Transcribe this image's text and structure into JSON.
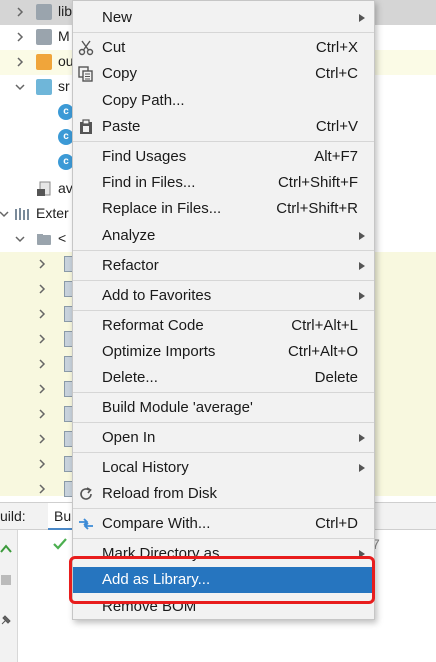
{
  "tree": {
    "items": [
      {
        "label": "lib"
      },
      {
        "label": "M"
      },
      {
        "label": "ou"
      },
      {
        "label": "sr"
      },
      {
        "label": "av"
      },
      {
        "label": "Exter"
      },
      {
        "label": "<"
      }
    ]
  },
  "build": {
    "label": "uild:",
    "tab": "Bu",
    "number": "7"
  },
  "menu": {
    "items": [
      {
        "label": "New",
        "shortcut": "",
        "submenu": true
      },
      {
        "label": "Cut",
        "shortcut": "Ctrl+X",
        "icon": "cut-icon"
      },
      {
        "label": "Copy",
        "shortcut": "Ctrl+C",
        "icon": "copy-icon"
      },
      {
        "label": "Copy Path...",
        "shortcut": ""
      },
      {
        "label": "Paste",
        "shortcut": "Ctrl+V",
        "icon": "paste-icon"
      },
      {
        "label": "Find Usages",
        "shortcut": "Alt+F7"
      },
      {
        "label": "Find in Files...",
        "shortcut": "Ctrl+Shift+F"
      },
      {
        "label": "Replace in Files...",
        "shortcut": "Ctrl+Shift+R"
      },
      {
        "label": "Analyze",
        "shortcut": "",
        "submenu": true
      },
      {
        "label": "Refactor",
        "shortcut": "",
        "submenu": true
      },
      {
        "label": "Add to Favorites",
        "shortcut": "",
        "submenu": true
      },
      {
        "label": "Reformat Code",
        "shortcut": "Ctrl+Alt+L"
      },
      {
        "label": "Optimize Imports",
        "shortcut": "Ctrl+Alt+O"
      },
      {
        "label": "Delete...",
        "shortcut": "Delete"
      },
      {
        "label": "Build Module 'average'",
        "shortcut": ""
      },
      {
        "label": "Open In",
        "shortcut": "",
        "submenu": true
      },
      {
        "label": "Local History",
        "shortcut": "",
        "submenu": true
      },
      {
        "label": "Reload from Disk",
        "shortcut": "",
        "icon": "reload-icon"
      },
      {
        "label": "Compare With...",
        "shortcut": "Ctrl+D",
        "icon": "compare-icon"
      },
      {
        "label": "Mark Directory as",
        "shortcut": "",
        "submenu": true
      },
      {
        "label": "Add as Library...",
        "shortcut": "",
        "selected": true
      },
      {
        "label": "Remove BOM",
        "shortcut": ""
      }
    ]
  },
  "colors": {
    "selection": "#2675bf",
    "highlight_box": "#e81d1d",
    "menu_bg": "#f2f2f2"
  }
}
